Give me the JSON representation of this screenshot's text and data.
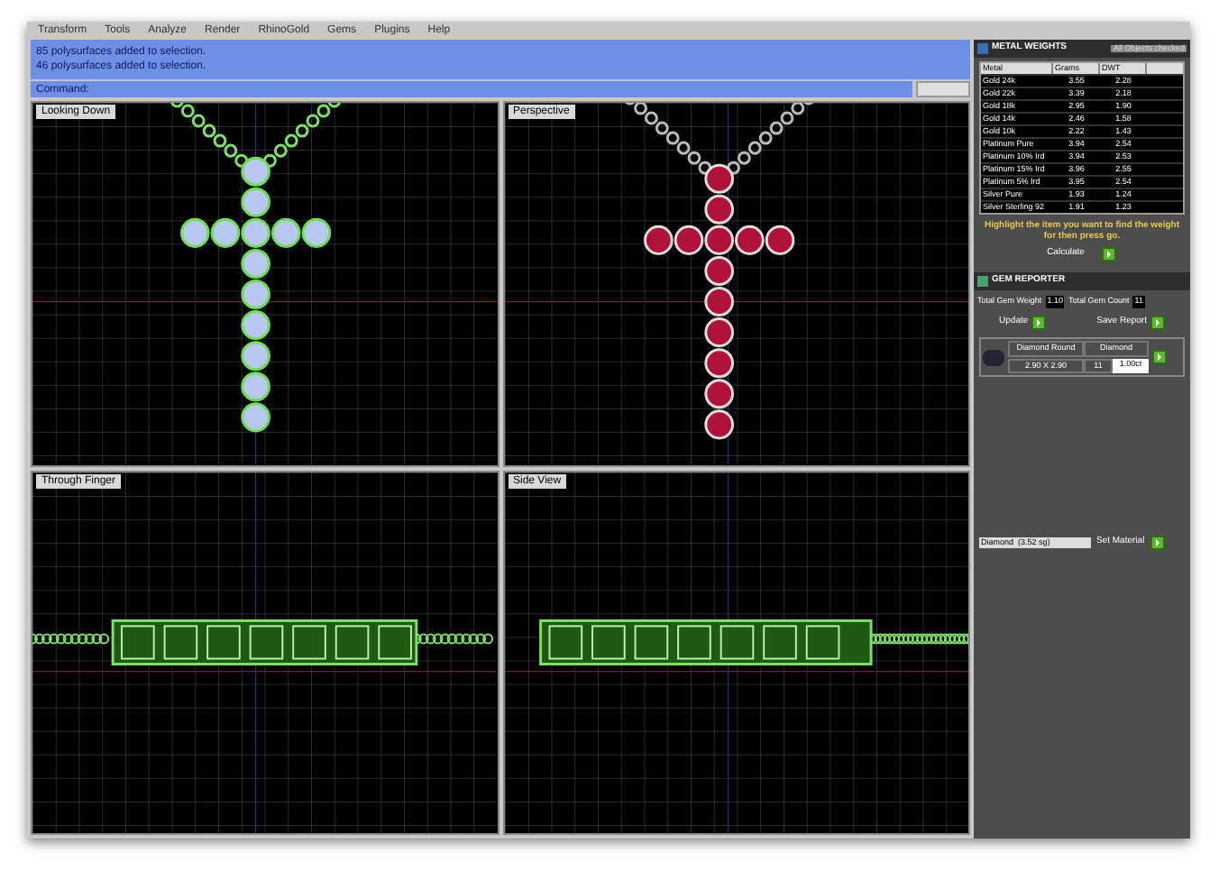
{
  "menu": [
    "Transform",
    "Tools",
    "Analyze",
    "Render",
    "RhinoGold",
    "Gems",
    "Plugins",
    "Help"
  ],
  "command_history": [
    "85 polysurfaces added to selection.",
    "46 polysurfaces added to selection."
  ],
  "command_prompt": "Command:",
  "viewports": [
    {
      "title": "Looking Down",
      "kind": "top"
    },
    {
      "title": "Perspective",
      "kind": "perspective"
    },
    {
      "title": "Through Finger",
      "kind": "front"
    },
    {
      "title": "Side View",
      "kind": "side"
    }
  ],
  "metal_weights": {
    "title": "METAL WEIGHTS",
    "mode": "All Objects checked",
    "columns": [
      "Metal",
      "Grams",
      "DWT"
    ],
    "rows": [
      [
        "Gold 24k",
        "3.55",
        "2.28"
      ],
      [
        "Gold 22k",
        "3.39",
        "2.18"
      ],
      [
        "Gold 18k",
        "2.95",
        "1.90"
      ],
      [
        "Gold 14k",
        "2.46",
        "1.58"
      ],
      [
        "Gold 10k",
        "2.22",
        "1.43"
      ],
      [
        "Platinum Pure",
        "3.94",
        "2.54"
      ],
      [
        "Platinum 10% Ird",
        "3.94",
        "2.53"
      ],
      [
        "Platinum 15% Ird",
        "3.96",
        "2.55"
      ],
      [
        "Platinum 5% Ird",
        "3.95",
        "2.54"
      ],
      [
        "Silver Pure",
        "1.93",
        "1.24"
      ],
      [
        "Silver Sterling 92",
        "1.91",
        "1.23"
      ]
    ],
    "hint": "Highlight the item you want to find the weight for then press go.",
    "calculate_label": "Calculate"
  },
  "gem_reporter": {
    "title": "GEM REPORTER",
    "total_weight_label": "Total Gem Weight",
    "total_weight": "1.10",
    "total_count_label": "Total Gem Count",
    "total_count": "11",
    "update_label": "Update",
    "save_label": "Save Report",
    "gems": [
      {
        "shape": "Diamond Round",
        "size": "2.90 X 2.90",
        "material": "Diamond",
        "count": "11",
        "weight": "1.00ct"
      }
    ],
    "material": "Diamond  (3.52 sg)",
    "set_material_label": "Set Material"
  }
}
